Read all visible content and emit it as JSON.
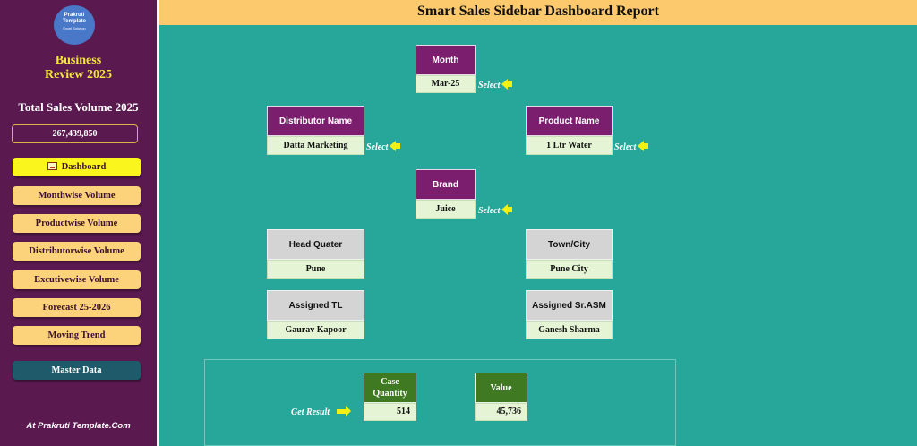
{
  "sidebar": {
    "logo": {
      "line1": "Prakruti Template",
      "line2": "Excel Solution"
    },
    "business_review": "Business Review 2025",
    "total_sales_label": "Total Sales Volume 2025",
    "total_sales_value": "267,439,850",
    "nav": [
      {
        "label": "Dashboard",
        "active": true,
        "icon": "presentation-icon"
      },
      {
        "label": "Monthwise Volume"
      },
      {
        "label": "Productwise Volume"
      },
      {
        "label": "Distributorwise Volume"
      },
      {
        "label": "Excutivewise Volume"
      },
      {
        "label": "Forecast 25-2026"
      },
      {
        "label": "Moving Trend"
      }
    ],
    "master_data": "Master Data",
    "footer": "At Prakruti Template.Com"
  },
  "header": {
    "title": "Smart Sales Sidebar Dashboard Report"
  },
  "filters": {
    "month": {
      "label": "Month",
      "value": "Mar-25"
    },
    "distributor": {
      "label": "Distributor Name",
      "value": "Datta Marketing"
    },
    "product": {
      "label": "Product Name",
      "value": "1 Ltr Water"
    },
    "brand": {
      "label": "Brand",
      "value": "Juice"
    },
    "select_hint": "Select"
  },
  "info": {
    "head_quater": {
      "label": "Head Quater",
      "value": "Pune"
    },
    "town_city": {
      "label": "Town/City",
      "value": "Pune City"
    },
    "assigned_tl": {
      "label": "Assigned TL",
      "value": "Gaurav Kapoor"
    },
    "assigned_asm": {
      "label": "Assigned Sr.ASM",
      "value": "Ganesh Sharma"
    }
  },
  "result": {
    "get_result": "Get Result",
    "case_quantity": {
      "label": "Case Quantity",
      "value": "514"
    },
    "value": {
      "label": "Value",
      "value": "45,736"
    }
  },
  "colors": {
    "sidebar_bg": "#5a1a50",
    "main_bg": "#27a69a",
    "title_bar": "#fcc96c",
    "nav_button": "#fcd27a",
    "active_button": "#f9f51d",
    "filter_header": "#7b1e6e",
    "result_header": "#3f7a22",
    "accent_yellow": "#f5e83a"
  }
}
